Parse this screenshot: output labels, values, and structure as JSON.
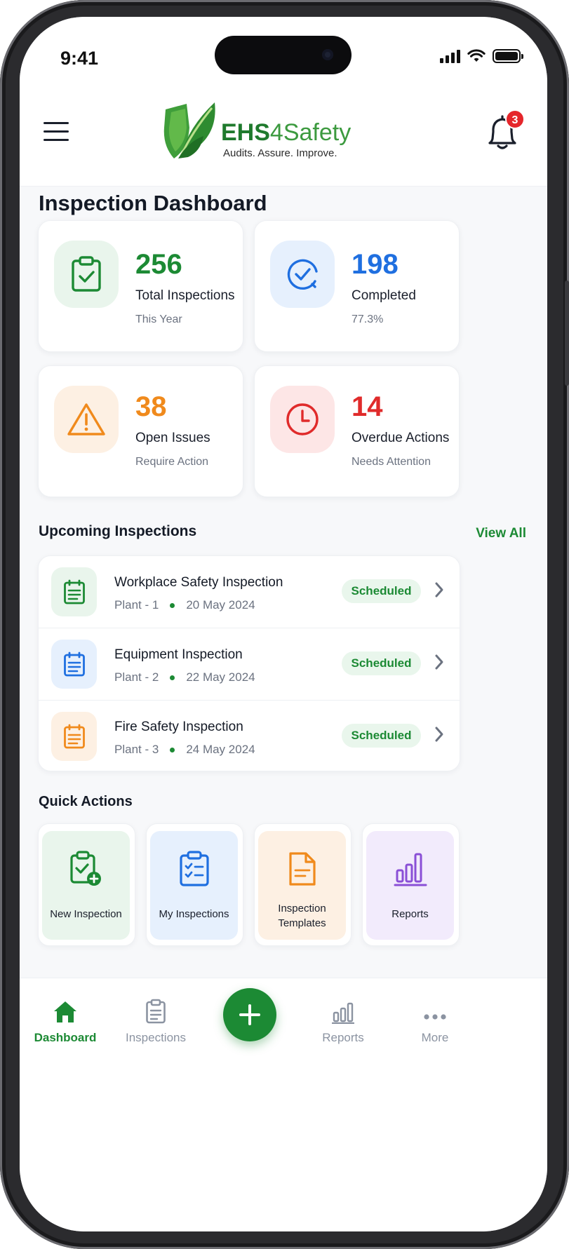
{
  "status_bar": {
    "time": "9:41"
  },
  "header": {
    "brand_ehs": "EHS",
    "brand_four": "4",
    "brand_safety": "Safety",
    "tagline": "Audits. Assure. Improve.",
    "notification_count": "3"
  },
  "page_title": "Inspection Dashboard",
  "stats": [
    {
      "value": "256",
      "label": "Total Inspections",
      "sub": "This Year",
      "color": "#1c8a34",
      "icon": "clipboard-check-icon"
    },
    {
      "value": "198",
      "label": "Completed",
      "sub": "77.3%",
      "color": "#1f6fe0",
      "icon": "check-circle-icon"
    },
    {
      "value": "38",
      "label": "Open Issues",
      "sub": "Require Action",
      "color": "#f08a1c",
      "icon": "warning-icon"
    },
    {
      "value": "14",
      "label": "Overdue Actions",
      "sub": "Needs Attention",
      "color": "#e02b2b",
      "icon": "clock-icon"
    }
  ],
  "upcoming": {
    "title": "Upcoming Inspections",
    "view_all": "View All",
    "items": [
      {
        "title": "Workplace Safety Inspection",
        "plant": "Plant - 1",
        "date": "20 May 2024",
        "status": "Scheduled",
        "color": "#1c8a34"
      },
      {
        "title": "Equipment Inspection",
        "plant": "Plant - 2",
        "date": "22 May 2024",
        "status": "Scheduled",
        "color": "#1f6fe0"
      },
      {
        "title": "Fire Safety Inspection",
        "plant": "Plant - 3",
        "date": "24 May 2024",
        "status": "Scheduled",
        "color": "#f08a1c"
      }
    ]
  },
  "quick_actions": {
    "title": "Quick Actions",
    "items": [
      {
        "label": "New Inspection",
        "icon": "clipboard-add-icon"
      },
      {
        "label": "My Inspections",
        "icon": "checklist-icon"
      },
      {
        "label_line1": "Inspection",
        "label_line2": "Templates",
        "icon": "document-icon"
      },
      {
        "label": "Reports",
        "icon": "bar-chart-icon"
      }
    ]
  },
  "bottom_nav": {
    "items": [
      {
        "label": "Dashboard",
        "icon": "home-icon",
        "active": true
      },
      {
        "label": "Inspections",
        "icon": "clipboard-icon"
      },
      {
        "label": "Reports",
        "icon": "bar-chart-icon"
      },
      {
        "label": "More",
        "icon": "more-icon"
      }
    ],
    "fab_icon": "plus-icon"
  },
  "colors": {
    "brand_green": "#1c8a34",
    "badge_red": "#e5262b"
  }
}
